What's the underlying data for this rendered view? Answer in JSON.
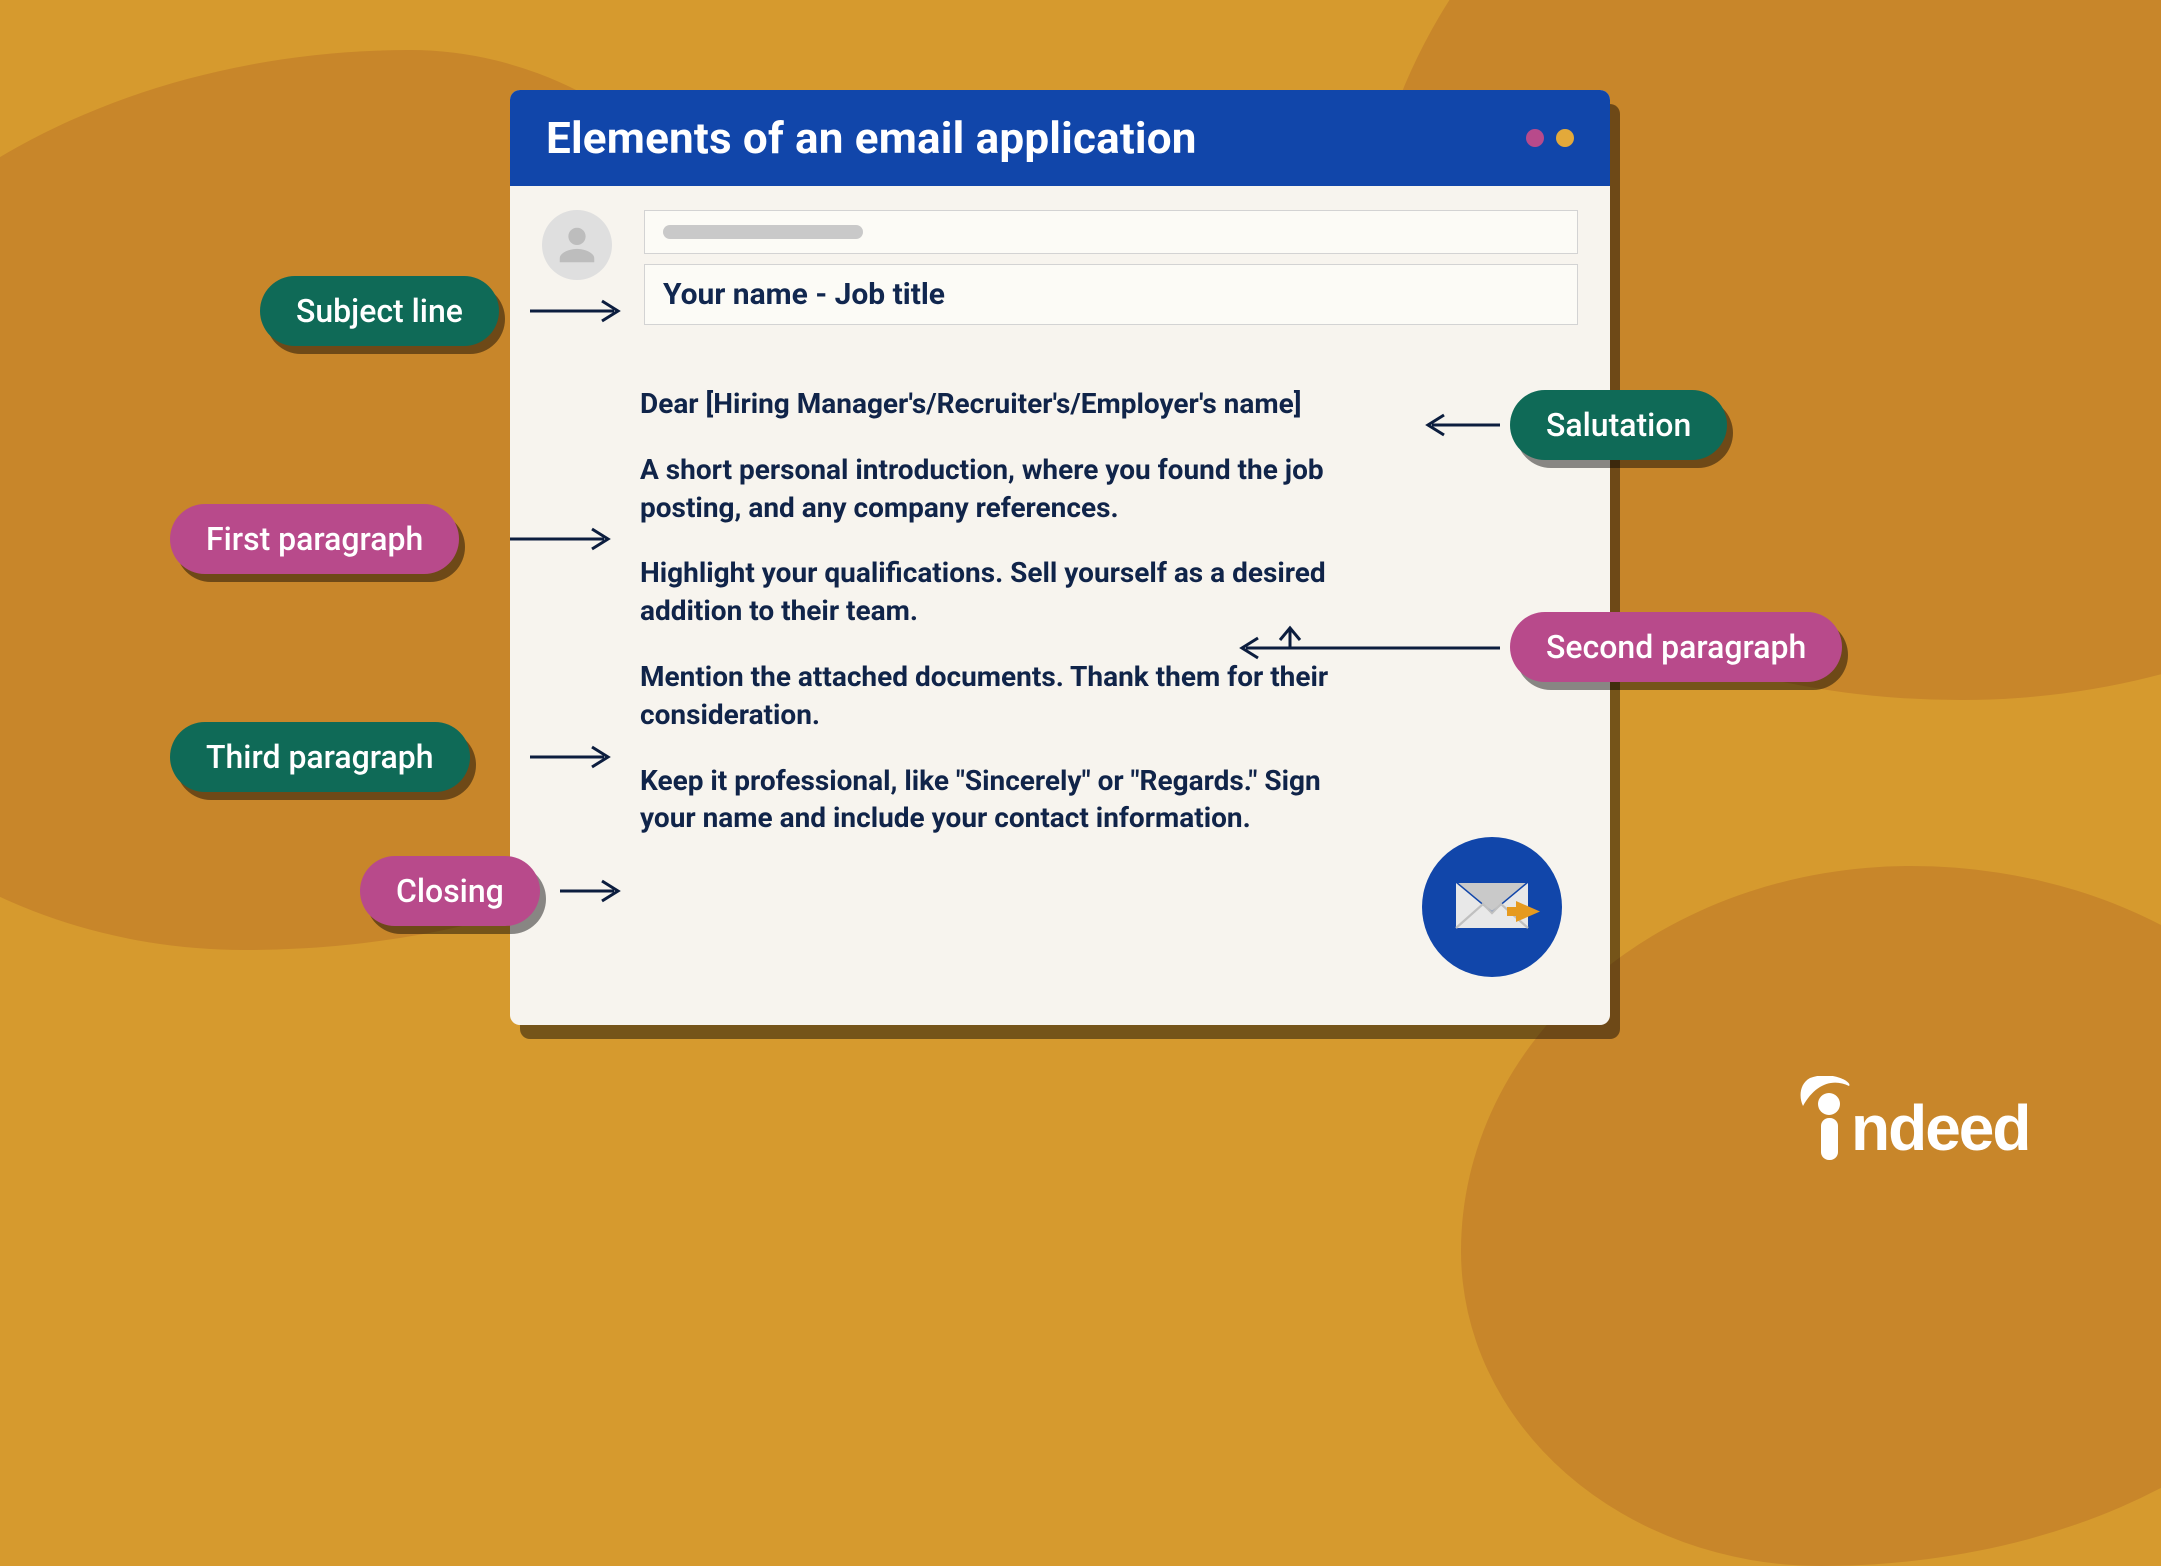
{
  "window": {
    "title": "Elements of an email application",
    "subject": "Your name - Job title",
    "salutation": "Dear [Hiring Manager's/Recruiter's/Employer's name]",
    "first_paragraph": "A short personal introduction, where you found the job posting, and any company references.",
    "second_paragraph": "Highlight your qualifications. Sell yourself as a desired addition to their team.",
    "third_paragraph": "Mention the attached documents. Thank them for their consideration.",
    "closing": "Keep it professional, like \"Sincerely\" or \"Regards.\" Sign your name and include your contact information."
  },
  "labels": {
    "subject_line": "Subject line",
    "salutation": "Salutation",
    "first_paragraph": "First paragraph",
    "second_paragraph": "Second paragraph",
    "third_paragraph": "Third paragraph",
    "closing": "Closing"
  },
  "brand": "indeed",
  "colors": {
    "bg": "#d69a2e",
    "blob": "#c8862a",
    "titlebar": "#1146aa",
    "pill_green": "#0f6a57",
    "pill_pink": "#b84a8b",
    "text_navy": "#102449"
  }
}
